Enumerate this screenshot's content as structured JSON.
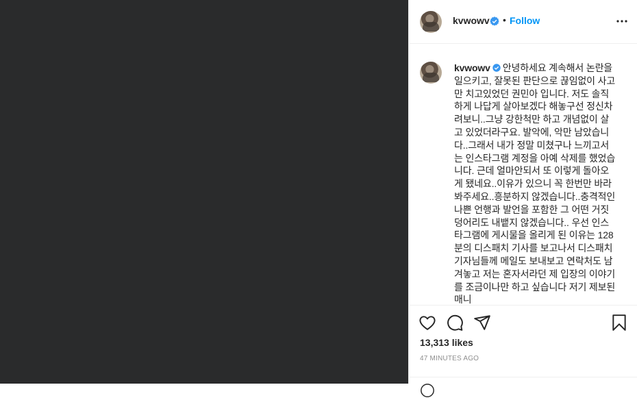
{
  "header": {
    "username": "kvwowv",
    "separator": "•",
    "follow_label": "Follow"
  },
  "caption": {
    "username": "kvwowv",
    "text": "안녕하세요 계속해서 논란을 일으키고, 잘못된 판단으로 끊임없이 사고만 치고있었던 권민아 입니다. 저도 솔직하게 나답게 살아보겠다 해놓구선 정신차려보니..그냥 강한척만 하고 개념없이 살고 있었더라구요. 발악에, 악만 남았습니다..그래서 내가 정말 미쳤구나 느끼고서는 인스타그램 계정을 아예 삭제를 했었습니다. 근데 얼마안되서 또 이렇게 돌아오게 됐네요..이유가 있으니 꼭 한번만 바라봐주세요..흥분하지 않겠습니다..충격적인 나쁜 언행과 발언을 포함한 그 어떤 거짓덩어리도 내뱉지 않겠습니다.. 우선 인스타그램에 게시물을 올리게 된 이유는 128분의 디스패치 기사를 보고나서 디스패치 기자님들께 메일도 보내보고 연락처도 남겨놓고 저는 혼자서라던 제 입장의 이야기를 조금이나만 하고 싶습니다 저기 제보된 매니"
  },
  "actions": {
    "icons": [
      "heart-icon",
      "comment-icon",
      "share-icon",
      "bookmark-icon"
    ],
    "likes": "13,313 likes",
    "timestamp": "47 MINUTES AGO"
  },
  "colors": {
    "media_bg": "#2a2b2c",
    "link_blue": "#0095f6",
    "verified_blue": "#3897f0",
    "muted": "#8e8e8e"
  }
}
